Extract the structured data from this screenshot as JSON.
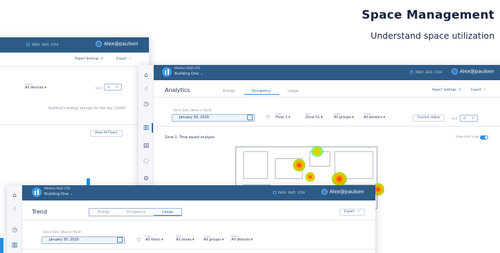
{
  "headline": {
    "title": "Space Management",
    "subtitle": "Understand space utilization"
  },
  "common": {
    "company": "Mediso R&D LTD",
    "building": "Building One",
    "stat_1": "6820",
    "stat_2": "3645",
    "stat_3": "1556",
    "user": "Alex@paulsen",
    "report_settings": "Report Settings",
    "export": "Export",
    "date_label": "Select Date, Week or Month",
    "date_value": "January 30, 2020"
  },
  "energy_window": {
    "device_label": "Device",
    "device_value": "All devices",
    "unit_label": "Unit",
    "savings_text": "Building's energy savings for the day 12kWh",
    "view_all_floors": "View All Floors"
  },
  "analytics_window": {
    "title": "Analytics",
    "tabs": [
      "Energy",
      "Occupancy",
      "Usage"
    ],
    "active_tab": "Occupancy",
    "filters": [
      {
        "label": "Floor",
        "value": "Floor 1"
      },
      {
        "label": "Zone",
        "value": "Zone 01"
      },
      {
        "label": "Group",
        "value": "All groups"
      },
      {
        "label": "Sensor",
        "value": "All sensors"
      }
    ],
    "current_status": "Current status",
    "unit_label": "Unit",
    "zone_title": "Zone 1- Time based analysis",
    "heatmap_label": "View heat map"
  },
  "trend_window": {
    "title": "Trend",
    "tabs": [
      "Energy",
      "Occupancy",
      "Usage"
    ],
    "active_tab": "Usage",
    "filters": [
      {
        "label": "Floor",
        "value": "All floors"
      },
      {
        "label": "Zone",
        "value": "All zones"
      },
      {
        "label": "Group",
        "value": "All groups"
      },
      {
        "label": "Device",
        "value": "All devices"
      }
    ]
  },
  "colors": {
    "topbar": "#2d5b88",
    "accent": "#2e8ee6",
    "bar": "#1e94e8"
  }
}
